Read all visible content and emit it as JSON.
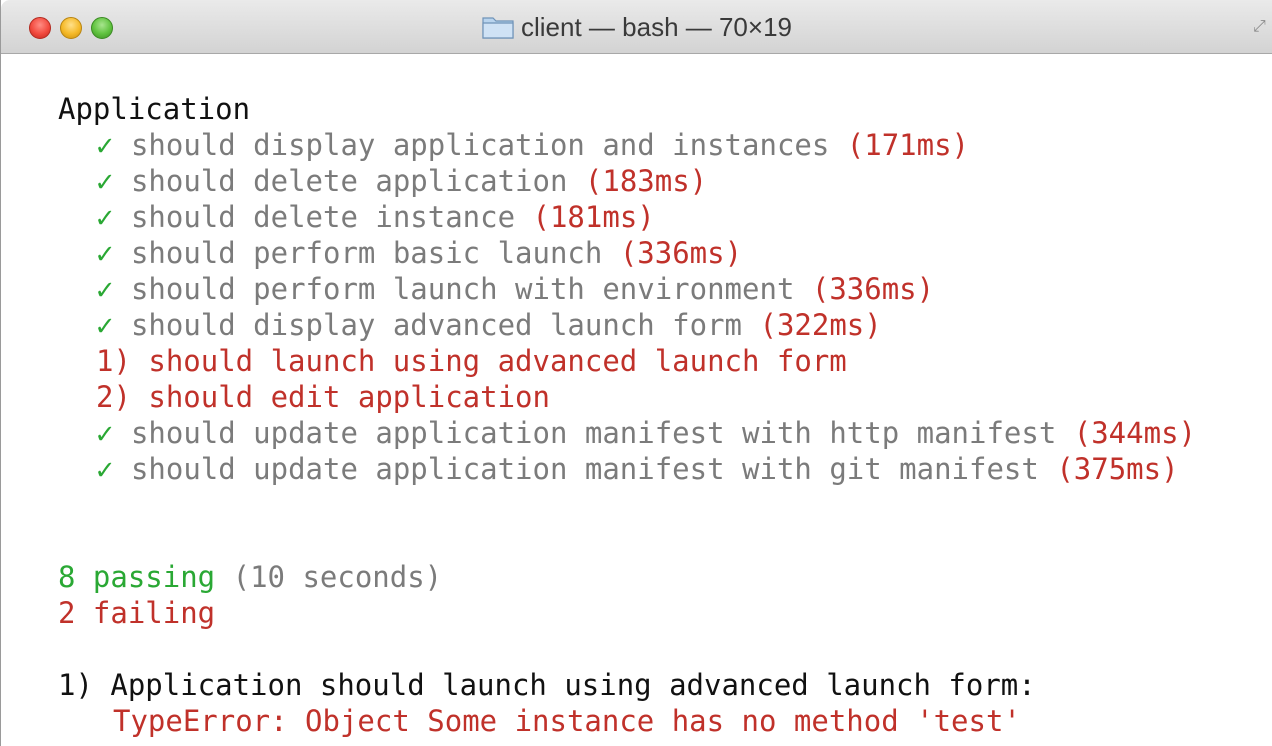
{
  "window": {
    "title": "client — bash — 70×19"
  },
  "terminal": {
    "suite_name": "Application",
    "check_mark": "✓",
    "tests": [
      {
        "status": "pass",
        "text": "should display application and instances",
        "duration": "(171ms)"
      },
      {
        "status": "pass",
        "text": "should delete application",
        "duration": "(183ms)"
      },
      {
        "status": "pass",
        "text": "should delete instance",
        "duration": "(181ms)"
      },
      {
        "status": "pass",
        "text": "should perform basic launch",
        "duration": "(336ms)"
      },
      {
        "status": "pass",
        "text": "should perform launch with environment",
        "duration": "(336ms)"
      },
      {
        "status": "pass",
        "text": "should display advanced launch form",
        "duration": "(322ms)"
      },
      {
        "status": "fail",
        "text": "1) should launch using advanced launch form"
      },
      {
        "status": "fail",
        "text": "2) should edit application"
      },
      {
        "status": "pass",
        "text": "should update application manifest with http manifest",
        "duration": "(344ms)"
      },
      {
        "status": "pass",
        "text": "should update application manifest with git manifest",
        "duration": "(375ms)"
      }
    ],
    "summary": {
      "passing": "8 passing",
      "passing_time": "(10 seconds)",
      "failing": "2 failing"
    },
    "failure": {
      "title": "1) Application should launch using advanced launch form:",
      "error": "TypeError: Object Some instance has no method 'test'"
    },
    "colors": {
      "pass": "#2aa834",
      "fail": "#c0312a",
      "muted": "#7b7b7b"
    }
  }
}
